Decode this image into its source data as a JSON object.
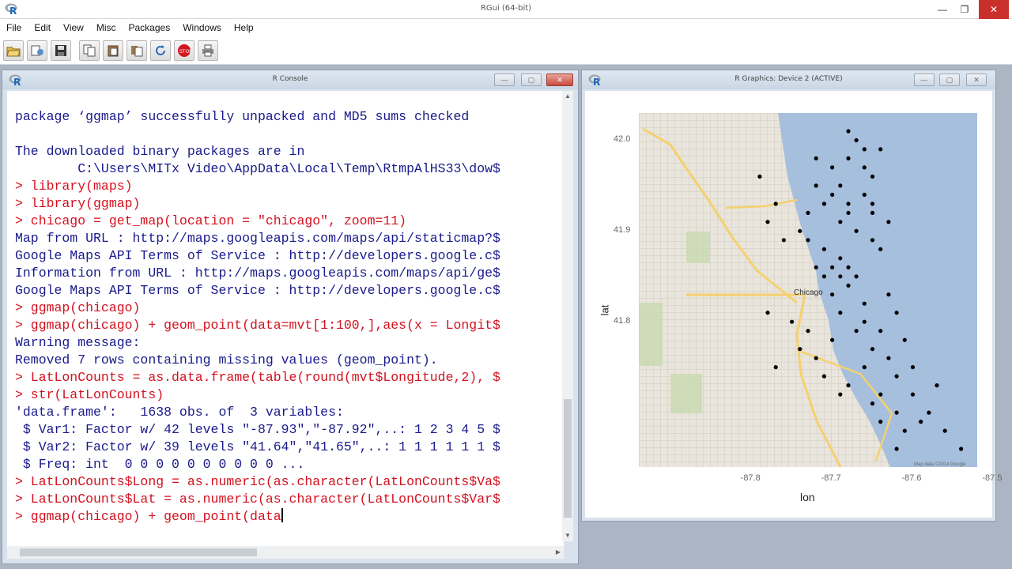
{
  "app": {
    "title": "RGui (64-bit)"
  },
  "menu": [
    "File",
    "Edit",
    "View",
    "Misc",
    "Packages",
    "Windows",
    "Help"
  ],
  "toolbar": {
    "icons": [
      "open-script-icon",
      "load-workspace-icon",
      "save-icon",
      "copy-icon",
      "paste-icon",
      "copy-paste-icon",
      "stop-icon",
      "print-icon"
    ]
  },
  "console": {
    "title": "R Console",
    "lines": [
      {
        "type": "out",
        "text": "package ‘ggmap’ successfully unpacked and MD5 sums checked"
      },
      {
        "type": "out",
        "text": ""
      },
      {
        "type": "out",
        "text": "The downloaded binary packages are in"
      },
      {
        "type": "out",
        "text": "        C:\\Users\\MITx Video\\AppData\\Local\\Temp\\RtmpAlHS33\\dow$"
      },
      {
        "type": "cmd",
        "text": "> library(maps)"
      },
      {
        "type": "cmd",
        "text": "> library(ggmap)"
      },
      {
        "type": "cmd",
        "text": "> chicago = get_map(location = \"chicago\", zoom=11)"
      },
      {
        "type": "out",
        "text": "Map from URL : http://maps.googleapis.com/maps/api/staticmap?$"
      },
      {
        "type": "out",
        "text": "Google Maps API Terms of Service : http://developers.google.c$"
      },
      {
        "type": "out",
        "text": "Information from URL : http://maps.googleapis.com/maps/api/ge$"
      },
      {
        "type": "out",
        "text": "Google Maps API Terms of Service : http://developers.google.c$"
      },
      {
        "type": "cmd",
        "text": "> ggmap(chicago)"
      },
      {
        "type": "cmd",
        "text": "> ggmap(chicago) + geom_point(data=mvt[1:100,],aes(x = Longit$"
      },
      {
        "type": "out",
        "text": "Warning message:"
      },
      {
        "type": "out",
        "text": "Removed 7 rows containing missing values (geom_point)."
      },
      {
        "type": "cmd",
        "text": "> LatLonCounts = as.data.frame(table(round(mvt$Longitude,2), $"
      },
      {
        "type": "cmd",
        "text": "> str(LatLonCounts)"
      },
      {
        "type": "out",
        "text": "'data.frame':   1638 obs. of  3 variables:"
      },
      {
        "type": "out",
        "text": " $ Var1: Factor w/ 42 levels \"-87.93\",\"-87.92\",..: 1 2 3 4 5 $"
      },
      {
        "type": "out",
        "text": " $ Var2: Factor w/ 39 levels \"41.64\",\"41.65\",..: 1 1 1 1 1 1 $"
      },
      {
        "type": "out",
        "text": " $ Freq: int  0 0 0 0 0 0 0 0 0 0 ..."
      },
      {
        "type": "cmd",
        "text": "> LatLonCounts$Long = as.numeric(as.character(LatLonCounts$Va$"
      },
      {
        "type": "cmd",
        "text": "> LatLonCounts$Lat = as.numeric(as.character(LatLonCounts$Var$"
      }
    ],
    "current_input": "> ggmap(chicago) + geom_point(data"
  },
  "graphics": {
    "title": "R Graphics: Device 2 (ACTIVE)",
    "map_labels": {
      "city": "Chicago",
      "credit": "Map data ©2014 Google"
    },
    "chart_data": {
      "type": "scatter",
      "xlabel": "lon",
      "ylabel": "lat",
      "x_ticks": [
        "-87.8",
        "-87.7",
        "-87.6",
        "-87.5"
      ],
      "y_ticks": [
        "42.0",
        "41.9",
        "41.8"
      ],
      "xlim": [
        -87.94,
        -87.52
      ],
      "ylim": [
        41.64,
        42.03
      ],
      "points": [
        [
          -87.67,
          42.0
        ],
        [
          -87.64,
          41.99
        ],
        [
          -87.68,
          41.98
        ],
        [
          -87.66,
          41.97
        ],
        [
          -87.65,
          41.96
        ],
        [
          -87.79,
          41.96
        ],
        [
          -87.72,
          41.95
        ],
        [
          -87.69,
          41.95
        ],
        [
          -87.66,
          41.94
        ],
        [
          -87.65,
          41.93
        ],
        [
          -87.7,
          41.94
        ],
        [
          -87.68,
          41.93
        ],
        [
          -87.77,
          41.93
        ],
        [
          -87.73,
          41.92
        ],
        [
          -87.71,
          41.93
        ],
        [
          -87.68,
          41.92
        ],
        [
          -87.65,
          41.92
        ],
        [
          -87.63,
          41.91
        ],
        [
          -87.78,
          41.91
        ],
        [
          -87.74,
          41.9
        ],
        [
          -87.69,
          41.91
        ],
        [
          -87.67,
          41.9
        ],
        [
          -87.65,
          41.89
        ],
        [
          -87.64,
          41.88
        ],
        [
          -87.76,
          41.89
        ],
        [
          -87.73,
          41.89
        ],
        [
          -87.71,
          41.88
        ],
        [
          -87.69,
          41.87
        ],
        [
          -87.7,
          41.86
        ],
        [
          -87.68,
          41.86
        ],
        [
          -87.67,
          41.85
        ],
        [
          -87.72,
          41.86
        ],
        [
          -87.71,
          41.85
        ],
        [
          -87.69,
          41.85
        ],
        [
          -87.68,
          41.84
        ],
        [
          -87.7,
          41.83
        ],
        [
          -87.66,
          41.82
        ],
        [
          -87.63,
          41.83
        ],
        [
          -87.62,
          41.81
        ],
        [
          -87.64,
          41.79
        ],
        [
          -87.67,
          41.79
        ],
        [
          -87.7,
          41.78
        ],
        [
          -87.65,
          41.77
        ],
        [
          -87.61,
          41.78
        ],
        [
          -87.63,
          41.76
        ],
        [
          -87.74,
          41.77
        ],
        [
          -87.72,
          41.76
        ],
        [
          -87.66,
          41.75
        ],
        [
          -87.62,
          41.74
        ],
        [
          -87.68,
          41.73
        ],
        [
          -87.64,
          41.72
        ],
        [
          -87.6,
          41.72
        ],
        [
          -87.57,
          41.73
        ],
        [
          -87.62,
          41.7
        ],
        [
          -87.59,
          41.69
        ],
        [
          -87.61,
          41.68
        ],
        [
          -87.56,
          41.68
        ],
        [
          -87.54,
          41.66
        ],
        [
          -87.62,
          41.66
        ],
        [
          -87.75,
          41.8
        ],
        [
          -87.73,
          41.79
        ],
        [
          -87.78,
          41.81
        ],
        [
          -87.69,
          41.81
        ],
        [
          -87.66,
          41.8
        ],
        [
          -87.71,
          41.74
        ],
        [
          -87.69,
          41.72
        ],
        [
          -87.65,
          41.71
        ],
        [
          -87.6,
          41.75
        ],
        [
          -87.64,
          41.69
        ],
        [
          -87.58,
          41.7
        ],
        [
          -87.77,
          41.75
        ],
        [
          -87.68,
          42.01
        ],
        [
          -87.7,
          41.97
        ],
        [
          -87.72,
          41.98
        ],
        [
          -87.66,
          41.99
        ]
      ]
    }
  }
}
